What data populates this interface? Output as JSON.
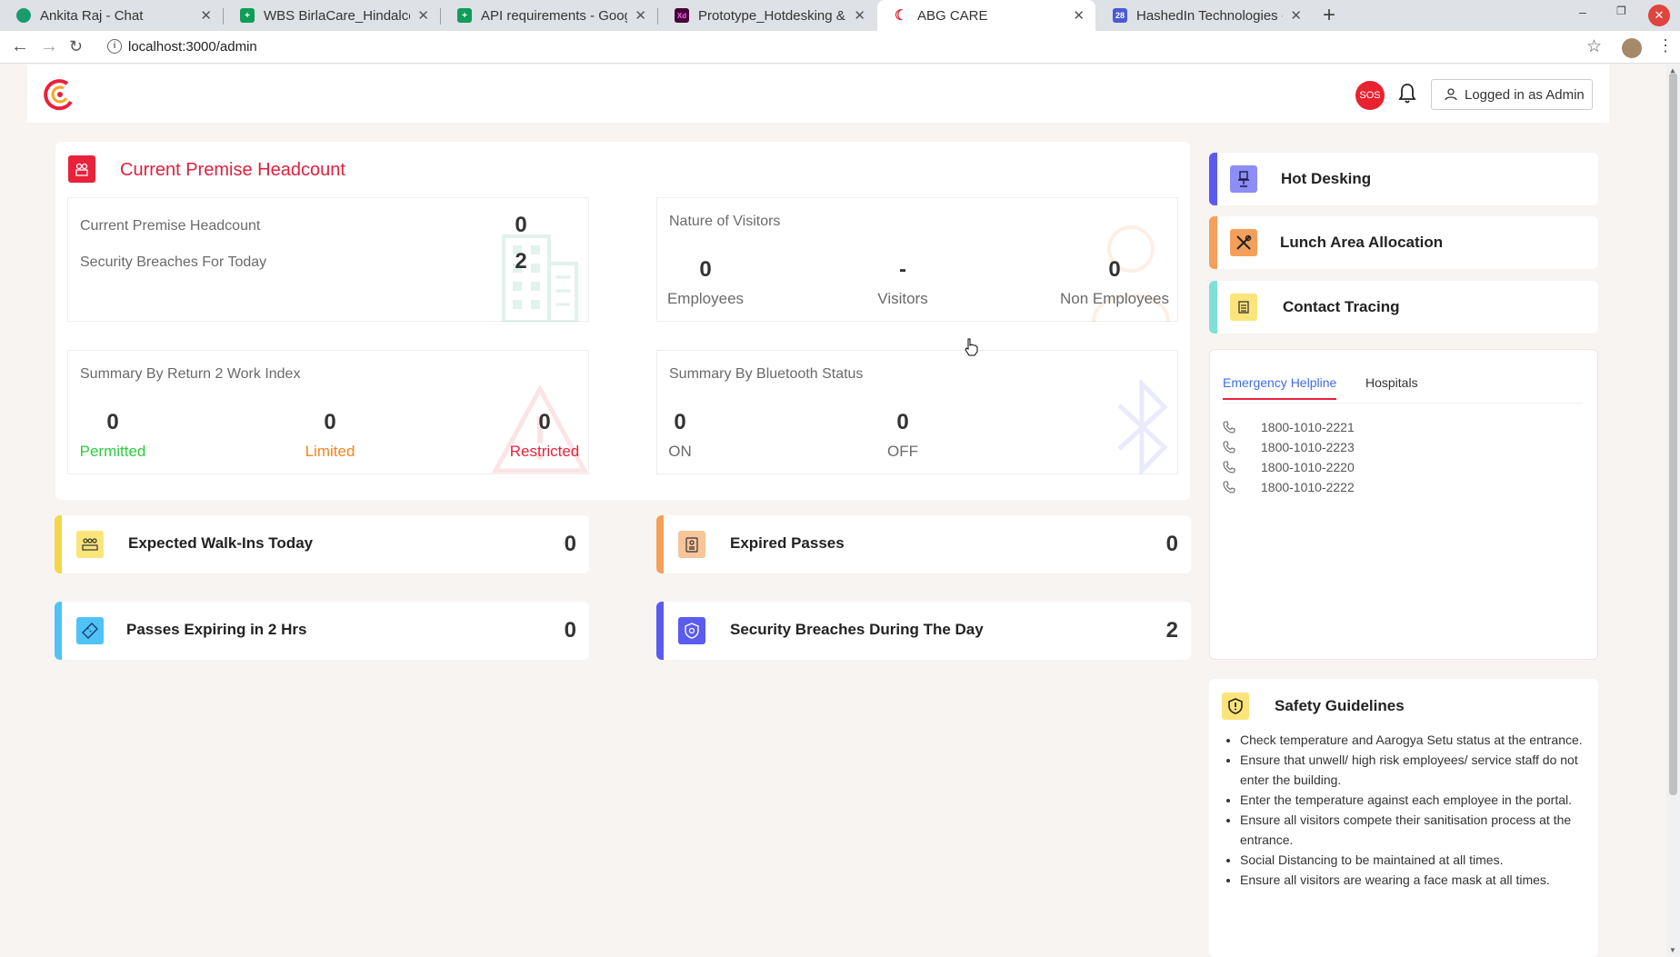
{
  "browser": {
    "tabs": [
      {
        "title": "Ankita Raj - Chat",
        "favicon_color": "#1a9b6e",
        "active": false
      },
      {
        "title": "WBS BirlaCare_Hindalco -",
        "favicon_color": "#0f9d58",
        "active": false
      },
      {
        "title": "API requirements - Googl",
        "favicon_color": "#0f9d58",
        "active": false
      },
      {
        "title": "Prototype_Hotdesking & I",
        "favicon_color": "#9b1b6f",
        "active": false
      },
      {
        "title": "ABG CARE",
        "favicon_color": "#e8223a",
        "active": true
      },
      {
        "title": "HashedIn Technologies - C",
        "favicon_color": "#4a5bd4",
        "active": false
      }
    ],
    "url": "localhost:3000/admin"
  },
  "header": {
    "sos_label": "SOS",
    "login_label": "Logged in as Admin"
  },
  "headcount": {
    "title": "Current Premise Headcount",
    "premise": {
      "headcount_label": "Current Premise Headcount",
      "headcount_value": "0",
      "breaches_label": "Security Breaches For Today",
      "breaches_value": "2"
    },
    "visitors": {
      "title": "Nature of Visitors",
      "employees_value": "0",
      "employees_label": "Employees",
      "visitors_value": "-",
      "visitors_label": "Visitors",
      "non_employees_value": "0",
      "non_employees_label": "Non Employees"
    },
    "r2w": {
      "title": "Summary By Return 2 Work Index",
      "permitted_value": "0",
      "permitted_label": "Permitted",
      "limited_value": "0",
      "limited_label": "Limited",
      "restricted_value": "0",
      "restricted_label": "Restricted"
    },
    "bluetooth": {
      "title": "Summary By Bluetooth Status",
      "on_value": "0",
      "on_label": "ON",
      "off_value": "0",
      "off_label": "OFF"
    }
  },
  "stats": {
    "walkins": {
      "label": "Expected Walk-Ins Today",
      "value": "0",
      "color": "#f5d54a"
    },
    "expired": {
      "label": "Expired Passes",
      "value": "0",
      "color": "#f5a05a"
    },
    "expiring": {
      "label": "Passes Expiring in 2 Hrs",
      "value": "0",
      "color": "#4fc3f7"
    },
    "breaches": {
      "label": "Security Breaches During The Day",
      "value": "2",
      "color": "#5b5bf0"
    }
  },
  "quick_links": {
    "hot_desking": "Hot Desking",
    "lunch": "Lunch Area Allocation",
    "contact_tracing": "Contact Tracing"
  },
  "help": {
    "tab_emergency": "Emergency Helpline",
    "tab_hospitals": "Hospitals",
    "phones": [
      "1800-1010-2221",
      "1800-1010-2223",
      "1800-1010-2220",
      "1800-1010-2222"
    ]
  },
  "safety": {
    "title": "Safety Guidelines",
    "items": [
      "Check temperature and Aarogya Setu status at the entrance.",
      "Ensure that unwell/ high risk employees/ service staff do not enter the building.",
      "Enter the temperature against each employee in the portal.",
      "Ensure all visitors compete their sanitisation process at the entrance.",
      "Social Distancing to be maintained at all times.",
      "Ensure all visitors are wearing a face mask at all times."
    ]
  },
  "colors": {
    "accent_red": "#e01f3d",
    "permitted": "#2ecc40",
    "limited": "#f5841f",
    "restricted": "#e8223a",
    "link_blue": "#3f6ee8"
  }
}
